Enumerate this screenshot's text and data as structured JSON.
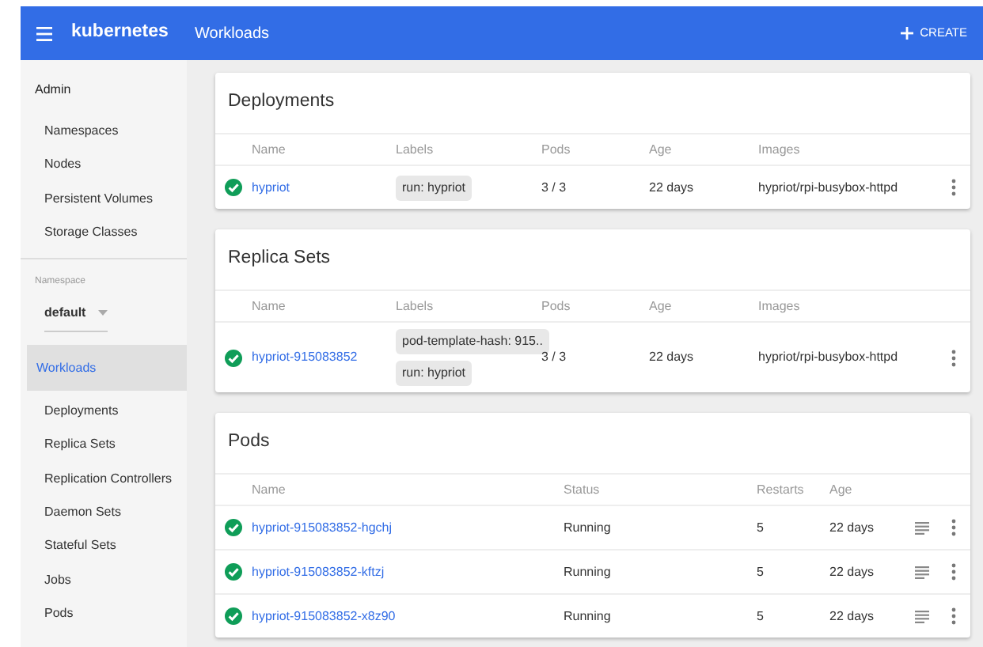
{
  "header": {
    "brand": "kubernetes",
    "title": "Workloads",
    "create_button": "CREATE"
  },
  "sidebar": {
    "admin": {
      "title": "Admin",
      "items": [
        {
          "label": "Namespaces",
          "selected": false
        },
        {
          "label": "Nodes",
          "selected": false
        },
        {
          "label": "Persistent Volumes",
          "selected": false
        },
        {
          "label": "Storage Classes",
          "selected": false
        }
      ]
    },
    "namespace": {
      "label": "Namespace",
      "value": "default"
    },
    "workloads": {
      "title": "Workloads",
      "selected": true,
      "items": [
        {
          "label": "Deployments",
          "selected": false
        },
        {
          "label": "Replica Sets",
          "selected": false
        },
        {
          "label": "Replication Controllers",
          "selected": false
        },
        {
          "label": "Daemon Sets",
          "selected": false
        },
        {
          "label": "Stateful Sets",
          "selected": false
        },
        {
          "label": "Jobs",
          "selected": false
        },
        {
          "label": "Pods",
          "selected": false
        }
      ]
    }
  },
  "deployments": {
    "title": "Deployments",
    "columns": [
      "Name",
      "Labels",
      "Pods",
      "Age",
      "Images"
    ],
    "rows": [
      {
        "healthy": true,
        "name": "hypriot",
        "labels": [
          "run: hypriot"
        ],
        "pods": "3 / 3",
        "age": "22 days",
        "images": "hypriot/rpi-busybox-httpd"
      }
    ]
  },
  "replica_sets": {
    "title": "Replica Sets",
    "columns": [
      "Name",
      "Labels",
      "Pods",
      "Age",
      "Images"
    ],
    "rows": [
      {
        "healthy": true,
        "name": "hypriot-915083852",
        "labels": [
          "pod-template-hash: 915..",
          "run: hypriot"
        ],
        "pods": "3 / 3",
        "age": "22 days",
        "images": "hypriot/rpi-busybox-httpd"
      }
    ]
  },
  "pods": {
    "title": "Pods",
    "columns": [
      "Name",
      "Status",
      "Restarts",
      "Age"
    ],
    "rows": [
      {
        "healthy": true,
        "name": "hypriot-915083852-hgchj",
        "status": "Running",
        "restarts": "5",
        "age": "22 days"
      },
      {
        "healthy": true,
        "name": "hypriot-915083852-kftzj",
        "status": "Running",
        "restarts": "5",
        "age": "22 days"
      },
      {
        "healthy": true,
        "name": "hypriot-915083852-x8z90",
        "status": "Running",
        "restarts": "5",
        "age": "22 days"
      }
    ]
  }
}
